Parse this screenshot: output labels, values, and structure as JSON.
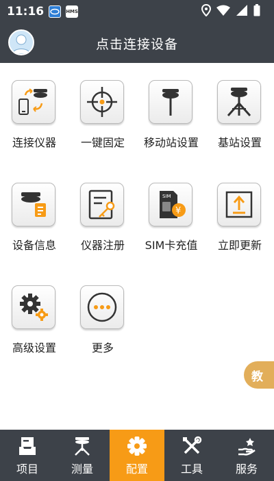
{
  "status": {
    "time": "11:16",
    "notif_b": "HMS"
  },
  "header": {
    "title": "点击连接设备"
  },
  "grid": [
    {
      "label": "连接仪器",
      "icon": "connect-instrument-icon"
    },
    {
      "label": "一键固定",
      "icon": "crosshair-icon"
    },
    {
      "label": "移动站设置",
      "icon": "rover-icon"
    },
    {
      "label": "基站设置",
      "icon": "base-station-icon"
    },
    {
      "label": "设备信息",
      "icon": "device-info-icon"
    },
    {
      "label": "仪器注册",
      "icon": "register-key-icon"
    },
    {
      "label": "SIM卡充值",
      "icon": "sim-card-icon"
    },
    {
      "label": "立即更新",
      "icon": "update-icon"
    },
    {
      "label": "高级设置",
      "icon": "gears-icon"
    },
    {
      "label": "更多",
      "icon": "more-icon"
    }
  ],
  "side_tab": {
    "label": "教"
  },
  "nav": [
    {
      "label": "项目",
      "icon": "project-icon",
      "active": false
    },
    {
      "label": "测量",
      "icon": "survey-icon",
      "active": false
    },
    {
      "label": "配置",
      "icon": "config-gear-icon",
      "active": true
    },
    {
      "label": "工具",
      "icon": "tools-icon",
      "active": false
    },
    {
      "label": "服务",
      "icon": "service-icon",
      "active": false
    }
  ],
  "colors": {
    "bar": "#3d4249",
    "accent": "#f79b16",
    "side_tab": "#e2ae5a"
  }
}
